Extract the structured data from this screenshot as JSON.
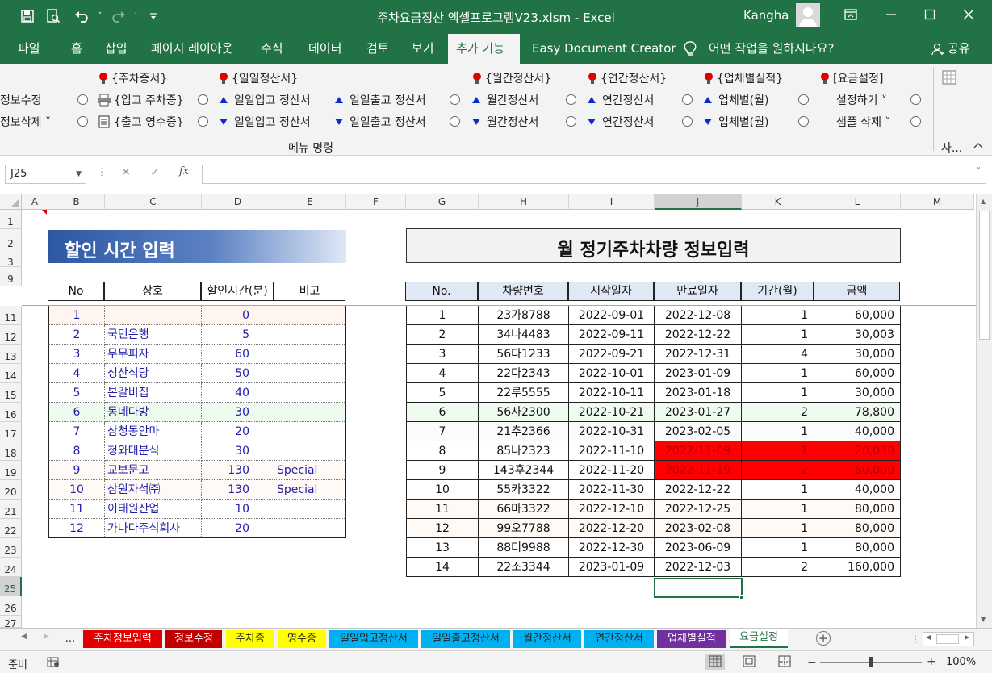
{
  "window": {
    "title": "주차요금정산 엑셀프로그램V23.xlsm  -  Excel",
    "user": "Kangha"
  },
  "menu": {
    "tabs": [
      "파일",
      "홈",
      "삽입",
      "페이지 레이아웃",
      "수식",
      "데이터",
      "검토",
      "보기",
      "추가 기능",
      "Easy Document Creator"
    ],
    "active": "추가 기능",
    "tell_me": "어떤 작업을 원하시나요?",
    "share": "공유"
  },
  "ribbon": {
    "left_items": [
      "정보수정",
      "정보삭제 ˅"
    ],
    "groups": [
      {
        "title": "{주차증서}",
        "items": [
          "{입고 주차증}",
          "{출고 영수증}"
        ]
      },
      {
        "title": "{일일정산서}",
        "items": [
          "일일입고 정산서",
          "일일입고 정산서",
          "일일출고 정산서",
          "일일출고 정산서"
        ]
      },
      {
        "title": "{월간정산서}",
        "items": [
          "월간정산서",
          "월간정산서"
        ]
      },
      {
        "title": "{연간정산서}",
        "items": [
          "연간정산서",
          "연간정산서"
        ]
      },
      {
        "title": "{업체별실적}",
        "items": [
          "업체별(월)",
          "업체별(월)"
        ]
      },
      {
        "title": "[요금설정]",
        "items": [
          "설정하기 ˅",
          "샘플 삭제 ˅"
        ]
      }
    ],
    "group_label": "메뉴 명령",
    "right_label": "사..."
  },
  "formula_bar": {
    "name_box": "J25",
    "cancel": "✕",
    "enter": "✓",
    "fx": "fx",
    "formula": ""
  },
  "columns": [
    "A",
    "B",
    "C",
    "D",
    "E",
    "F",
    "G",
    "H",
    "I",
    "J",
    "K",
    "L",
    "M"
  ],
  "rows": [
    "1",
    "2",
    "3",
    "9",
    "11",
    "12",
    "13",
    "14",
    "15",
    "16",
    "17",
    "18",
    "19",
    "20",
    "21",
    "22",
    "23",
    "24",
    "25",
    "26",
    "27"
  ],
  "discount": {
    "title": "할인 시간 입력",
    "headers": [
      "No",
      "상호",
      "할인시간(분)",
      "비고"
    ],
    "rows": [
      [
        "1",
        "",
        "0",
        ""
      ],
      [
        "2",
        "국민은행",
        "5",
        ""
      ],
      [
        "3",
        "무무피자",
        "60",
        ""
      ],
      [
        "4",
        "성산식당",
        "50",
        ""
      ],
      [
        "5",
        "본갈비집",
        "40",
        ""
      ],
      [
        "6",
        "동네다방",
        "30",
        ""
      ],
      [
        "7",
        "삼청동안마",
        "20",
        ""
      ],
      [
        "8",
        "청와대분식",
        "30",
        ""
      ],
      [
        "9",
        "교보문고",
        "130",
        "Special"
      ],
      [
        "10",
        "삼원자석㈜",
        "130",
        "Special"
      ],
      [
        "11",
        "이태원산업",
        "10",
        ""
      ],
      [
        "12",
        "가나다주식회사",
        "20",
        ""
      ]
    ]
  },
  "monthly": {
    "title": "월 정기주차차량 정보입력",
    "headers": [
      "No.",
      "차량번호",
      "시작일자",
      "만료일자",
      "기간(월)",
      "금액"
    ],
    "rows": [
      [
        "1",
        "23가8788",
        "2022-09-01",
        "2022-12-08",
        "1",
        "60,000"
      ],
      [
        "2",
        "34나4483",
        "2022-09-11",
        "2022-12-22",
        "1",
        "30,003"
      ],
      [
        "3",
        "56다1233",
        "2022-09-21",
        "2022-12-31",
        "4",
        "30,000"
      ],
      [
        "4",
        "22다2343",
        "2022-10-01",
        "2023-01-09",
        "1",
        "60,000"
      ],
      [
        "5",
        "22루5555",
        "2022-10-11",
        "2023-01-18",
        "1",
        "30,000"
      ],
      [
        "6",
        "56사2300",
        "2022-10-21",
        "2023-01-27",
        "2",
        "78,800"
      ],
      [
        "7",
        "21추2366",
        "2022-10-31",
        "2023-02-05",
        "1",
        "40,000"
      ],
      [
        "8",
        "85나2323",
        "2022-11-10",
        "2022-11-09",
        "1",
        "20,030"
      ],
      [
        "9",
        "143후2344",
        "2022-11-20",
        "2022-11-19",
        "2",
        "80,000"
      ],
      [
        "10",
        "55카3322",
        "2022-11-30",
        "2022-12-22",
        "1",
        "40,000"
      ],
      [
        "11",
        "66마3322",
        "2022-12-10",
        "2022-12-25",
        "1",
        "80,000"
      ],
      [
        "12",
        "99오7788",
        "2022-12-20",
        "2023-02-08",
        "1",
        "80,000"
      ],
      [
        "13",
        "88더9988",
        "2022-12-30",
        "2023-06-09",
        "1",
        "80,000"
      ],
      [
        "14",
        "22조3344",
        "2023-01-09",
        "2022-12-03",
        "2",
        "160,000"
      ]
    ],
    "expired_rows": [
      7,
      8
    ]
  },
  "sheets": [
    {
      "name": "...",
      "bg": "#f3f3f3",
      "fg": "#222222"
    },
    {
      "name": "주차정보입력",
      "bg": "#e00000",
      "fg": "#ffffff"
    },
    {
      "name": "정보수정",
      "bg": "#c00000",
      "fg": "#ffffff"
    },
    {
      "name": "주차증",
      "bg": "#ffff00",
      "fg": "#222222"
    },
    {
      "name": "영수증",
      "bg": "#ffff00",
      "fg": "#222222"
    },
    {
      "name": "일일입고정산서",
      "bg": "#00b0f0",
      "fg": "#222222"
    },
    {
      "name": "일일출고정산서",
      "bg": "#00b0f0",
      "fg": "#222222"
    },
    {
      "name": "월간정산서",
      "bg": "#00b0f0",
      "fg": "#222222"
    },
    {
      "name": "연간정산서",
      "bg": "#00b0f0",
      "fg": "#222222"
    },
    {
      "name": "업체별실적",
      "bg": "#7030a0",
      "fg": "#ffffff"
    },
    {
      "name": "요금설정",
      "bg": "#ffffff",
      "fg": "#217346"
    }
  ],
  "status": {
    "ready": "준비",
    "zoom": "100%"
  },
  "colors": {
    "excel_green": "#217346",
    "expired_red": "#ff0000",
    "cell_blue": "#1f1fa8"
  }
}
